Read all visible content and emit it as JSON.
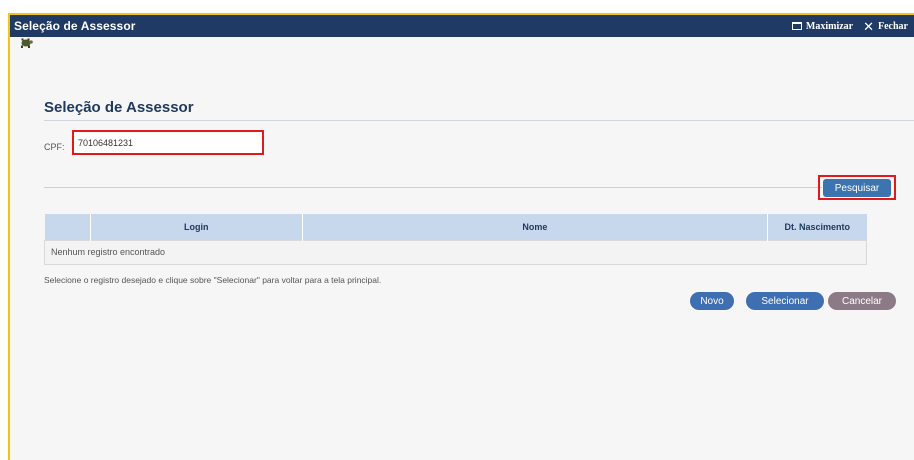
{
  "window": {
    "title": "Seleção de Assessor",
    "maximize_label": "Maximizar",
    "close_label": "Fechar",
    "turtle_icon": "turtle-icon"
  },
  "page": {
    "heading": "Seleção de Assessor"
  },
  "form": {
    "cpf_label": "CPF:",
    "cpf_value": "70106481231",
    "search_button": "Pesquisar"
  },
  "table": {
    "columns": [
      "",
      "Login",
      "Nome",
      "Dt. Nascimento"
    ],
    "empty_message": "Nenhum registro encontrado"
  },
  "footer": {
    "hint": "Selecione o registro desejado e clique sobre \"Selecionar\" para voltar para a tela principal.",
    "new_button": "Novo",
    "select_button": "Selecionar",
    "cancel_button": "Cancelar"
  },
  "colors": {
    "titlebar": "#1f3a64",
    "frame_border": "#f0c419",
    "highlight": "#e01a1a",
    "primary_button": "#3f6fb3",
    "cancel_button": "#8c7a86",
    "table_header": "#c7d8ed"
  }
}
